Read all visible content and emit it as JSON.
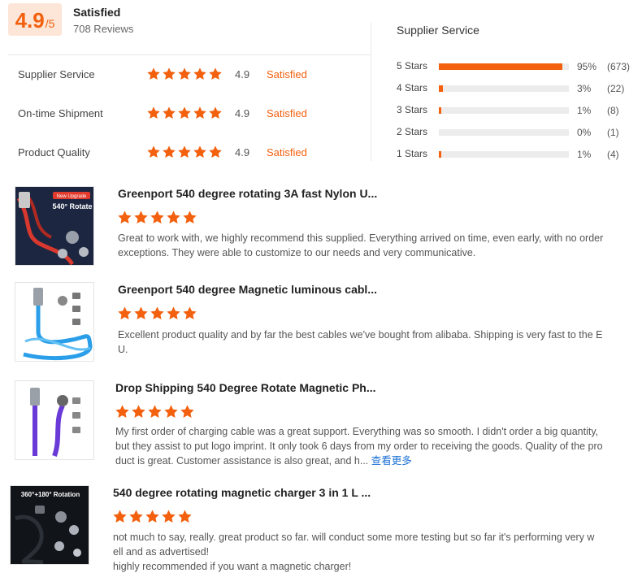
{
  "summary": {
    "score": "4.9",
    "score_max": "/5",
    "label": "Satisfied",
    "reviews": "708 Reviews"
  },
  "categories": [
    {
      "label": "Supplier Service",
      "score": "4.9",
      "status": "Satisfied",
      "stars": 5
    },
    {
      "label": "On-time Shipment",
      "score": "4.9",
      "status": "Satisfied",
      "stars": 5
    },
    {
      "label": "Product Quality",
      "score": "4.9",
      "status": "Satisfied",
      "stars": 5
    }
  ],
  "distribution": {
    "title": "Supplier Service",
    "rows": [
      {
        "label": "5 Stars",
        "pct": "95%",
        "count": "(673)",
        "fraction": 0.95
      },
      {
        "label": "4 Stars",
        "pct": "3%",
        "count": "(22)",
        "fraction": 0.03
      },
      {
        "label": "3 Stars",
        "pct": "1%",
        "count": "(8)",
        "fraction": 0.01
      },
      {
        "label": "2 Stars",
        "pct": "0%",
        "count": "(1)",
        "fraction": 0.0
      },
      {
        "label": "1 Stars",
        "pct": "1%",
        "count": "(4)",
        "fraction": 0.01
      }
    ]
  },
  "reviews": [
    {
      "title": "Greenport 540 degree rotating 3A fast Nylon U...",
      "stars": 5,
      "text_lines": [
        "Great to work with, we highly recommend this supplied.  Everything arrived on time, even early, with no order",
        "exceptions.  They were able to customize to our needs and very communicative."
      ],
      "thumb_text": [
        "New Upgrade",
        "540° Rotate"
      ]
    },
    {
      "title": "Greenport 540 degree Magnetic luminous cabl...",
      "stars": 5,
      "text_lines": [
        "Excellent product quality and by far the best cables we've bought from alibaba. Shipping is very fast to the E",
        "U."
      ],
      "thumb_text": []
    },
    {
      "title": "Drop Shipping 540 Degree Rotate Magnetic Ph...",
      "stars": 5,
      "text_lines": [
        "My first order of charging cable was a great support. Everything was so smooth. I didn't order a big quantity,",
        "but they assist to put logo imprint. It only took 6 days from my order to receiving the goods. Quality of the pro",
        "duct is great. Customer assistance is also great, and h..."
      ],
      "see_more": "查看更多",
      "thumb_text": []
    },
    {
      "title": "540 degree rotating magnetic charger 3 in 1 L ...",
      "stars": 5,
      "text_lines": [
        "not much to say, really. great product so far. will conduct some more testing but so far it's performing very w",
        "ell and as advertised!",
        "highly recommended if you want a magnetic charger!"
      ],
      "thumb_text": [
        "360°+180° Rotation"
      ]
    }
  ],
  "colors": {
    "accent": "#f3600e",
    "link": "#1a6fd4"
  }
}
